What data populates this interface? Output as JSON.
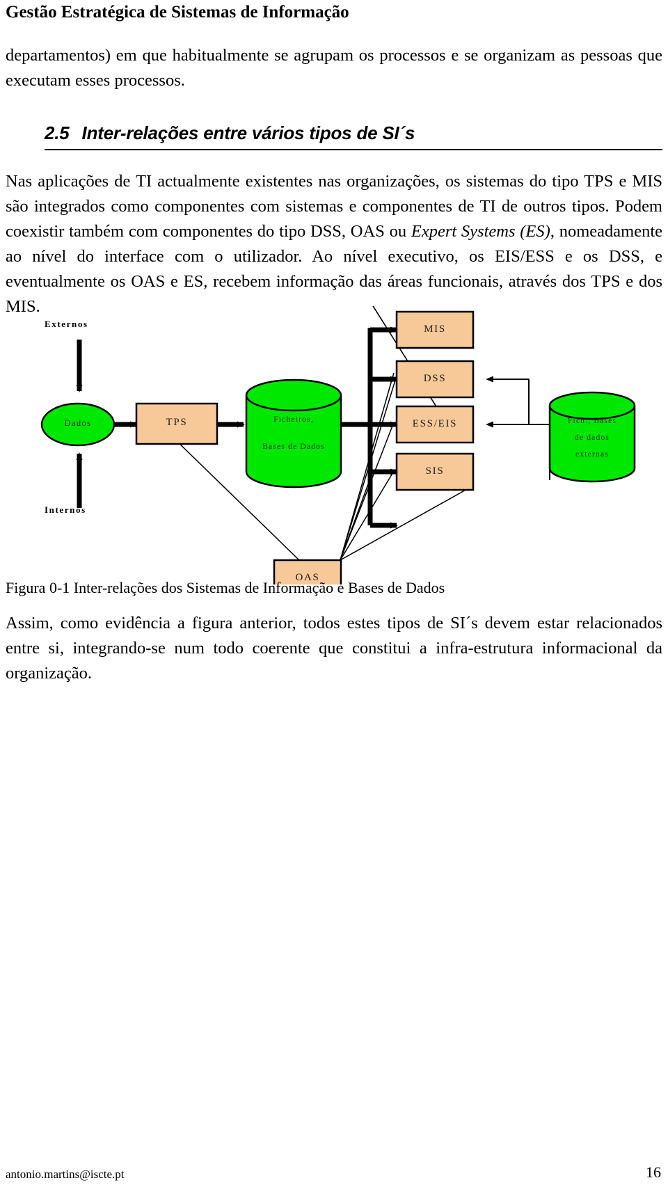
{
  "header": {
    "title": "Gestão Estratégica de Sistemas de Informação"
  },
  "paragraphs": {
    "intro": "departamentos) em que habitualmente se agrupam os processos e se organizam as pessoas que executam esses processos.",
    "body_part1": "Nas aplicações de TI actualmente existentes nas organizações, os sistemas do tipo TPS e MIS são integrados como componentes com sistemas e componentes de TI de outros tipos. Podem coexistir também com componentes do tipo DSS, OAS ou ",
    "body_italic1": "Expert Systems (ES)",
    "body_part2": ", nomeadamente ao nível do interface com o utilizador. Ao nível executivo, os EIS/ESS e os DSS, e eventualmente os OAS e ES, recebem informação das áreas funcionais, através dos TPS e dos MIS.",
    "closing": "Assim, como evidência a figura anterior, todos estes tipos de SI´s devem estar relacionados entre si, integrando-se num todo coerente que constitui a infra-estrutura informacional da organização."
  },
  "section": {
    "number": "2.5",
    "title": "Inter-relações entre vários tipos de SI´s"
  },
  "figure": {
    "caption": "Figura 0-1 Inter-relações dos Sistemas de Informação e Bases de Dados",
    "labels": {
      "externos": "Externos",
      "internos": "Internos"
    },
    "nodes": {
      "dados": "Dados",
      "tps": "TPS",
      "db_center_line1": "Ficheiros,",
      "db_center_line2": "Bases de Dados",
      "mis": "MIS",
      "dss": "DSS",
      "ess_eis": "ESS/EIS",
      "sis": "SIS",
      "oas": "OAS",
      "db_ext_line1": "Fich., Bases",
      "db_ext_line2": "de dados",
      "db_ext_line3": "externas"
    },
    "colors": {
      "process_fill": "#F7C999",
      "process_stroke": "#000000",
      "data_fill": "#00E800",
      "data_stroke": "#000000",
      "arrow": "#000000"
    }
  },
  "footer": {
    "email": "antonio.martins@iscte.pt",
    "page_number": "16"
  }
}
